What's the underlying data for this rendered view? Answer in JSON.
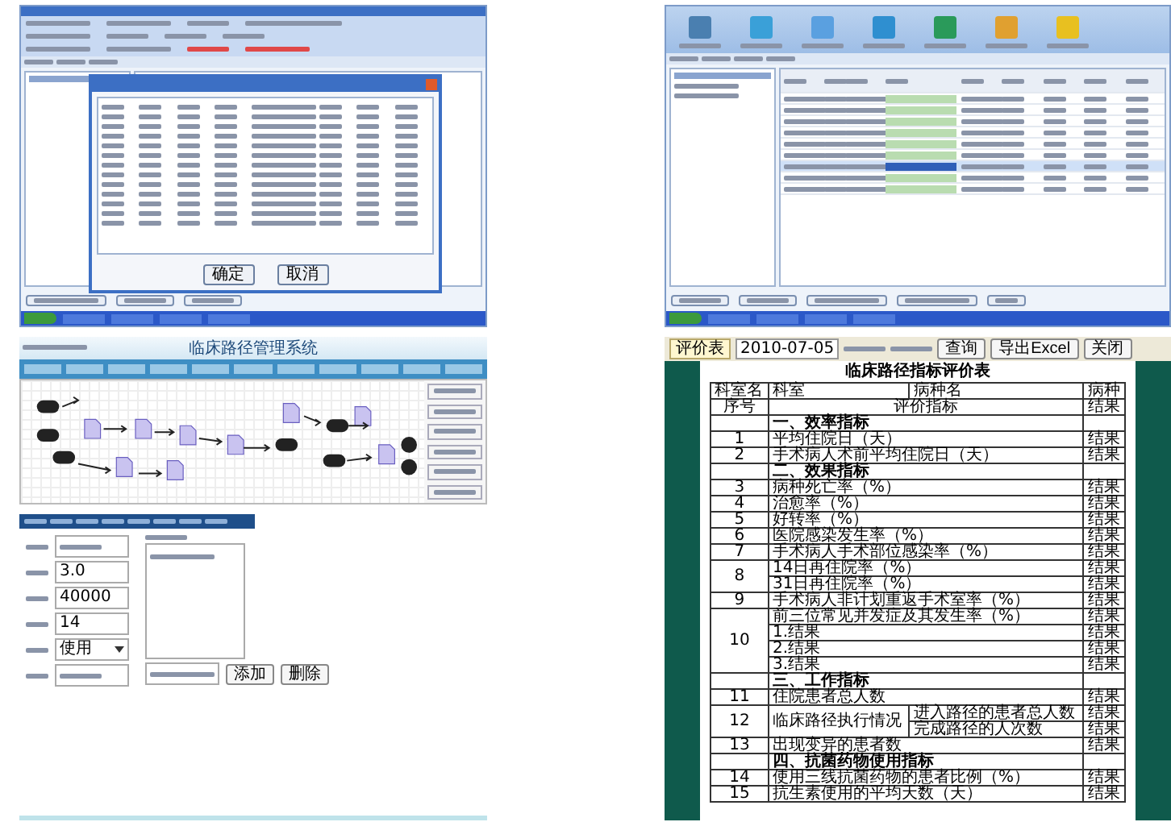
{
  "order_window": {
    "dialog": {
      "buttons": [
        "确定",
        "取消"
      ]
    }
  },
  "order_table_window": {
    "rows": [
      {
        "selected": false
      },
      {
        "selected": false
      },
      {
        "selected": false
      },
      {
        "selected": false
      },
      {
        "selected": false
      },
      {
        "selected": false
      },
      {
        "selected": true
      },
      {
        "selected": false
      },
      {
        "selected": false
      }
    ]
  },
  "pathway_designer": {
    "title": "临床路径管理系统",
    "form": {
      "fields": [
        {
          "kind": "text"
        },
        {
          "kind": "text",
          "value": "3.0"
        },
        {
          "kind": "text",
          "value": "40000"
        },
        {
          "kind": "text",
          "value": "14"
        },
        {
          "kind": "select",
          "value": "使用"
        },
        {
          "kind": "text"
        }
      ],
      "buttons": [
        "添加",
        "删除"
      ]
    }
  },
  "evaluation_report": {
    "toolbar": {
      "date": "2010-07-05",
      "buttons": [
        "查询",
        "导出Excel",
        "关闭"
      ]
    },
    "tab": "评价表",
    "title": "临床路径指标评价表",
    "meta": [
      "科室名",
      "科室",
      "病种名",
      "病种"
    ],
    "columns": [
      "序号",
      "评价指标",
      "结果"
    ],
    "rows": [
      {
        "kind": "section",
        "label": "一、效率指标"
      },
      {
        "kind": "item",
        "no": "1",
        "lines": [
          {
            "label": "平均住院日（天）",
            "result": "结果"
          }
        ]
      },
      {
        "kind": "item",
        "no": "2",
        "lines": [
          {
            "label": "手术病人术前平均住院日（天）",
            "result": "结果"
          }
        ]
      },
      {
        "kind": "section",
        "label": "二、效果指标"
      },
      {
        "kind": "item",
        "no": "3",
        "lines": [
          {
            "label": "病种死亡率（%）",
            "result": "结果"
          }
        ]
      },
      {
        "kind": "item",
        "no": "4",
        "lines": [
          {
            "label": "治愈率（%）",
            "result": "结果"
          }
        ]
      },
      {
        "kind": "item",
        "no": "5",
        "lines": [
          {
            "label": "好转率（%）",
            "result": "结果"
          }
        ]
      },
      {
        "kind": "item",
        "no": "6",
        "lines": [
          {
            "label": "医院感染发生率（%）",
            "result": "结果"
          }
        ]
      },
      {
        "kind": "item",
        "no": "7",
        "lines": [
          {
            "label": "手术病人手术部位感染率（%）",
            "result": "结果"
          }
        ]
      },
      {
        "kind": "item",
        "no": "8",
        "lines": [
          {
            "label": "14日再住院率（%）",
            "result": "结果"
          },
          {
            "label": "31日再住院率（%）",
            "result": "结果"
          }
        ]
      },
      {
        "kind": "item",
        "no": "9",
        "lines": [
          {
            "label": "手术病人非计划重返手术室率（%）",
            "result": "结果"
          }
        ]
      },
      {
        "kind": "item",
        "no": "10",
        "lines": [
          {
            "label": "前三位常见并发症及其发生率（%）",
            "result": "结果"
          },
          {
            "label": "1.结果",
            "result": "结果"
          },
          {
            "label": "2.结果",
            "result": "结果"
          },
          {
            "label": "3.结果",
            "result": "结果"
          }
        ]
      },
      {
        "kind": "section",
        "label": "三、工作指标"
      },
      {
        "kind": "item",
        "no": "11",
        "lines": [
          {
            "label": "住院患者总人数",
            "result": "结果"
          }
        ]
      },
      {
        "kind": "split",
        "no": "12",
        "label": "临床路径执行情况",
        "lines": [
          {
            "label": "进入路径的患者总人数",
            "result": "结果"
          },
          {
            "label": "完成路径的人次数",
            "result": "结果"
          }
        ]
      },
      {
        "kind": "item",
        "no": "13",
        "lines": [
          {
            "label": "出现变异的患者数",
            "result": "结果"
          }
        ]
      },
      {
        "kind": "section",
        "label": "四、抗菌药物使用指标"
      },
      {
        "kind": "item",
        "no": "14",
        "lines": [
          {
            "label": "使用三线抗菌药物的患者比例（%）",
            "result": "结果"
          }
        ]
      },
      {
        "kind": "item",
        "no": "15",
        "lines": [
          {
            "label": "抗生素使用的平均天数（天）",
            "result": "结果"
          }
        ]
      }
    ]
  }
}
